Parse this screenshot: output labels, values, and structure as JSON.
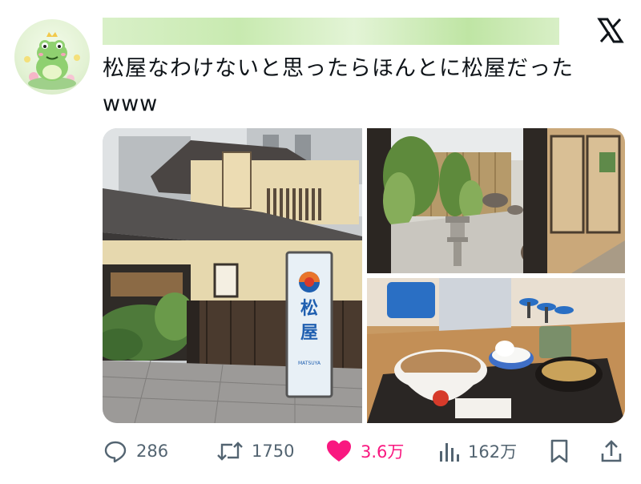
{
  "tweet": {
    "text_line1": "松屋なわけないと思ったらほんとに松屋だった",
    "text_line2": "www"
  },
  "photos": {
    "sign_text": "松屋",
    "sign_brand": "MATSUYA"
  },
  "actions": {
    "replies": "286",
    "reposts": "1750",
    "likes": "3.6万",
    "views": "162万"
  },
  "colors": {
    "like": "#f91880",
    "icon": "#536471",
    "text": "#0f1419"
  },
  "icons": [
    "frog-avatar",
    "x-logo-icon",
    "reply-icon",
    "repost-icon",
    "heart-icon",
    "views-icon",
    "bookmark-icon",
    "share-icon"
  ]
}
